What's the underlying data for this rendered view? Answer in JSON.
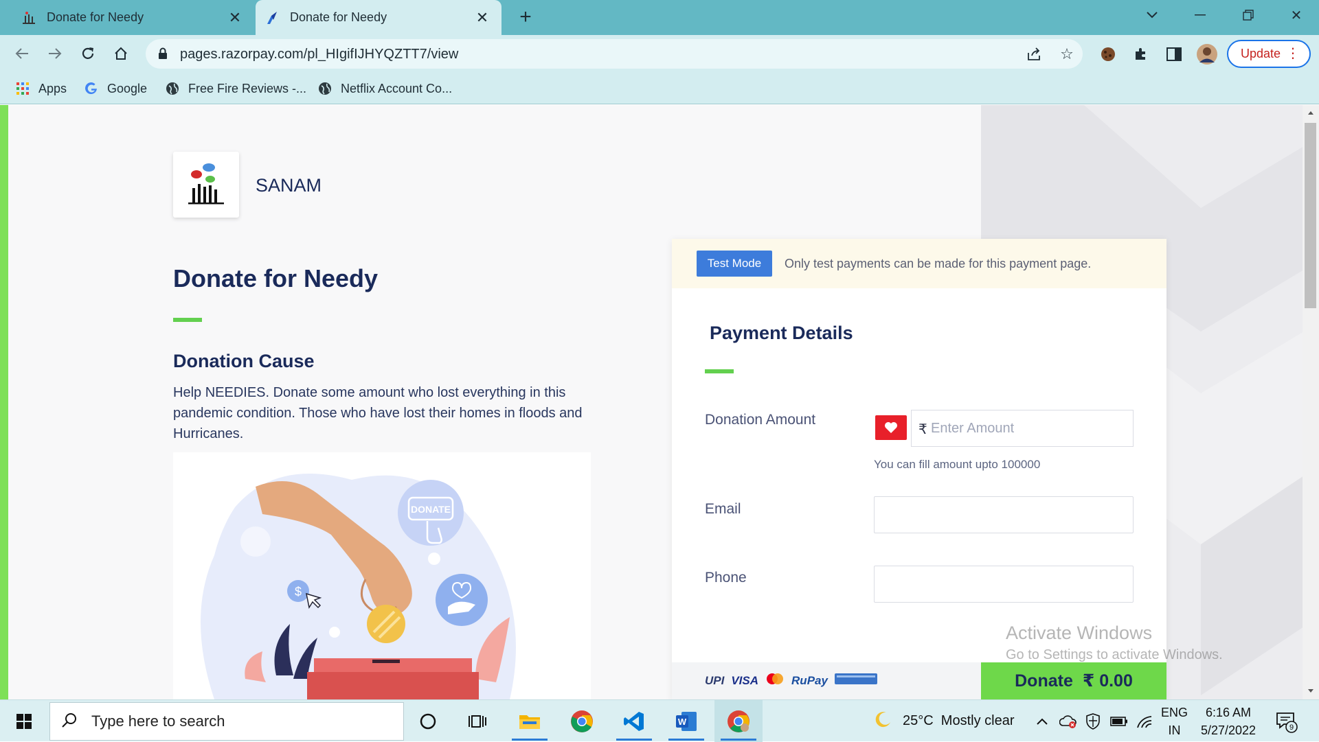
{
  "browser": {
    "tabs": [
      {
        "title": "Donate for Needy",
        "active": false
      },
      {
        "title": "Donate for Needy",
        "active": true
      }
    ],
    "url": "pages.razorpay.com/pl_HIgifIJHYQZTT7/view",
    "update_label": "Update",
    "bookmarks": [
      "Apps",
      "Google",
      "Free Fire Reviews -...",
      "Netflix Account Co..."
    ]
  },
  "page": {
    "merchant_name": "SANAM",
    "title": "Donate for Needy",
    "section_title": "Donation Cause",
    "description": "Help NEEDIES. Donate some amount who lost everything in this pandemic condition. Those who have lost their homes in floods and Hurricanes.",
    "illustration_text": "DONATE"
  },
  "payment": {
    "test_badge": "Test Mode",
    "test_message": "Only test payments can be made for this payment page.",
    "heading": "Payment Details",
    "amount_label": "Donation Amount",
    "currency_symbol": "₹",
    "amount_placeholder": "Enter Amount",
    "amount_hint": "You can fill amount upto 100000",
    "email_label": "Email",
    "phone_label": "Phone",
    "email_value": "",
    "phone_value": "",
    "payment_logos": [
      "UPI",
      "VISA",
      "RuPay"
    ],
    "donate_label": "Donate",
    "donate_amount": "₹ 0.00"
  },
  "watermark": {
    "line1": "Activate Windows",
    "line2": "Go to Settings to activate Windows."
  },
  "taskbar": {
    "search_placeholder": "Type here to search",
    "weather": "25°C  Mostly clear",
    "lang_top": "ENG",
    "lang_bottom": "IN",
    "time": "6:16 AM",
    "date": "5/27/2022",
    "notification_count": "9"
  },
  "colors": {
    "accent_green": "#6ed84a",
    "title_navy": "#1a2a5a",
    "test_badge_blue": "#3d7cdb",
    "chrome_teal": "#63b8c4"
  }
}
